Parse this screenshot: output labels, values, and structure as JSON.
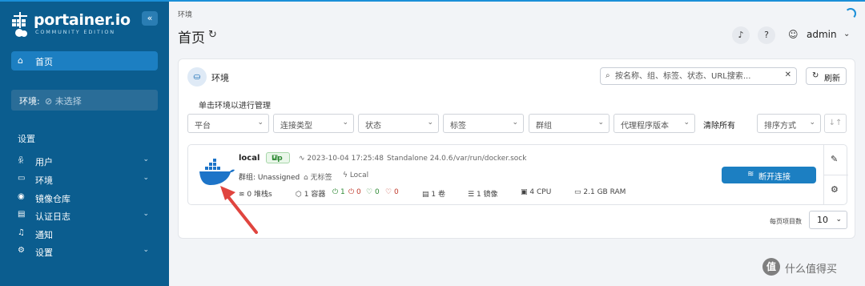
{
  "app": {
    "brand": "portainer.io",
    "edition": "COMMUNITY EDITION",
    "collapse_icon": "«"
  },
  "sidebar": {
    "home_label": "首页",
    "env_label": "环境:",
    "env_value": "未选择",
    "settings_title": "设置",
    "items": [
      {
        "label": "用户",
        "icon": "users-icon",
        "glyph": "👤",
        "has_chevron": true
      },
      {
        "label": "环境",
        "icon": "environment-icon",
        "glyph": "▭",
        "has_chevron": true
      },
      {
        "label": "镜像仓库",
        "icon": "registry-icon",
        "glyph": "◉",
        "has_chevron": false
      },
      {
        "label": "认证日志",
        "icon": "log-icon",
        "glyph": "▤",
        "has_chevron": true
      },
      {
        "label": "通知",
        "icon": "bell-icon",
        "glyph": "🔔",
        "has_chevron": false
      },
      {
        "label": "设置",
        "icon": "gear-icon",
        "glyph": "⚙",
        "has_chevron": true
      }
    ],
    "chevron": "⌄"
  },
  "header": {
    "breadcrumb": "环境",
    "title": "首页",
    "user": "admin"
  },
  "panel": {
    "title": "环境",
    "search_placeholder": "按名称、组、标签、状态、URL搜索...",
    "refresh_label": "刷新",
    "hint": "单击环境以进行管理",
    "filters": [
      "平台",
      "连接类型",
      "状态",
      "标签",
      "群组",
      "代理程序版本"
    ],
    "clear_all": "清除所有",
    "sort_label": "排序方式",
    "sort_icon": "↓↑"
  },
  "environment": {
    "name": "local",
    "status": "Up",
    "timestamp": "2023-10-04 17:25:48",
    "type": "Standalone 24.0.6",
    "socket": "/var/run/docker.sock",
    "group": "群组: Unassigned",
    "tags": "无标签",
    "locality": "Local",
    "stacks": "0 堆栈s",
    "containers": "1 容器",
    "running": "1",
    "stopped": "0",
    "healthy": "0",
    "unhealthy": "0",
    "volumes": "1 卷",
    "images": "1 镜像",
    "cpu": "4 CPU",
    "ram": "2.1 GB RAM",
    "disconnect_label": "断开连接"
  },
  "pagination": {
    "label": "每页项目数",
    "value": "10"
  },
  "watermark": {
    "glyph": "值",
    "text": "什么值得买"
  },
  "colors": {
    "sidebar": "#0b5d8f",
    "accent": "#1c7fc2",
    "arrow": "#e0453f"
  }
}
